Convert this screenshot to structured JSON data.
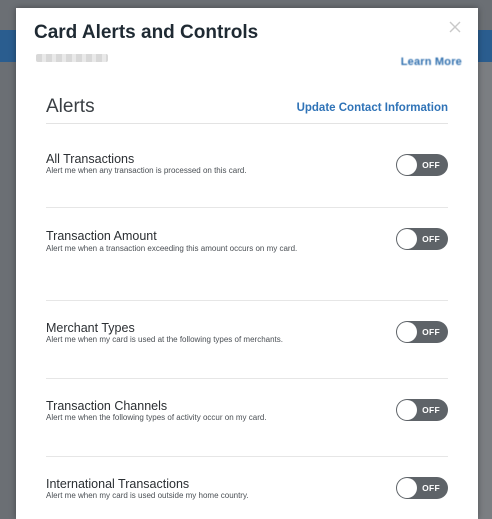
{
  "modal": {
    "title": "Card Alerts and Controls",
    "learn_more_label": "Learn More"
  },
  "section": {
    "title": "Alerts",
    "update_contact_label": "Update Contact Information"
  },
  "alerts": [
    {
      "title": "All Transactions",
      "description": "Alert me when any transaction is processed on this card.",
      "toggle_label": "OFF"
    },
    {
      "title": "Transaction Amount",
      "description": "Alert me when a transaction exceeding this amount occurs on my card.",
      "toggle_label": "OFF"
    },
    {
      "title": "Merchant Types",
      "description": "Alert me when my card is used at the following types of merchants.",
      "toggle_label": "OFF"
    },
    {
      "title": "Transaction Channels",
      "description": "Alert me when the following types of activity occur on my card.",
      "toggle_label": "OFF"
    },
    {
      "title": "International Transactions",
      "description": "Alert me when my card is used outside my home country.",
      "toggle_label": "OFF"
    }
  ],
  "colors": {
    "link": "#2f73b7",
    "toggle_off": "#5e6368"
  }
}
